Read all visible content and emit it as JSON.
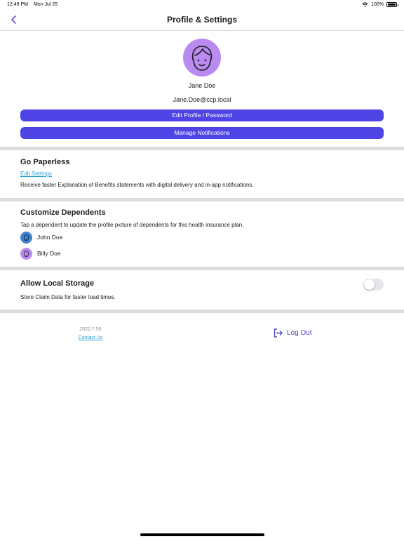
{
  "status_bar": {
    "time": "12:49 PM",
    "date": "Mon Jul 25",
    "battery": "100%",
    "wifi_icon": "wifi-icon",
    "battery_icon": "battery-icon"
  },
  "nav": {
    "title": "Profile & Settings",
    "back_icon": "chevron-left-icon"
  },
  "profile": {
    "name": "Jane Doe",
    "email": "Jane.Doe@ccp.local",
    "avatar_icon": "user-face-icon",
    "edit_label": "Edit Profile / Password",
    "notifications_label": "Manage Notifications"
  },
  "paperless": {
    "title": "Go Paperless",
    "link": "Edit Settings",
    "description": "Receive faster Explanation of Benefits statements with digital delivery and in-app notifications."
  },
  "dependents": {
    "title": "Customize Dependents",
    "description": "Tap a dependent to update the profile picture of dependents for this health insurance plan.",
    "items": [
      {
        "name": "John Doe",
        "avatar_color": "#3d84d6",
        "icon": "user-face-icon"
      },
      {
        "name": "Billy Doe",
        "avatar_color": "#b98af0",
        "icon": "user-face-icon"
      }
    ]
  },
  "storage": {
    "title": "Allow Local Storage",
    "description": "Store Claim Data for faster load times.",
    "enabled": false
  },
  "footer": {
    "version": "2022.7.50",
    "contact": "Contact Us",
    "logout": "Log Out",
    "logout_icon": "logout-icon"
  },
  "colors": {
    "accent": "#4e44e6",
    "link": "#2aa0d8",
    "divider": "#dcdcde",
    "avatar": "#b98af0"
  }
}
